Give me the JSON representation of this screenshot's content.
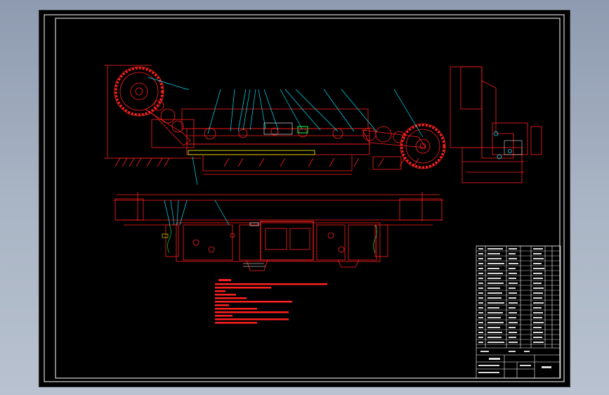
{
  "colors": {
    "drawing": "#ff2020",
    "leader": "#00e5ff",
    "frame": "#ffffff",
    "highlight": "#ffff00",
    "accent": "#00ff40",
    "background": "#000000"
  },
  "title_block": {
    "drawing_title": "",
    "scale_label": "",
    "sheet_label": ""
  },
  "notes": {
    "header": "",
    "lines": []
  }
}
